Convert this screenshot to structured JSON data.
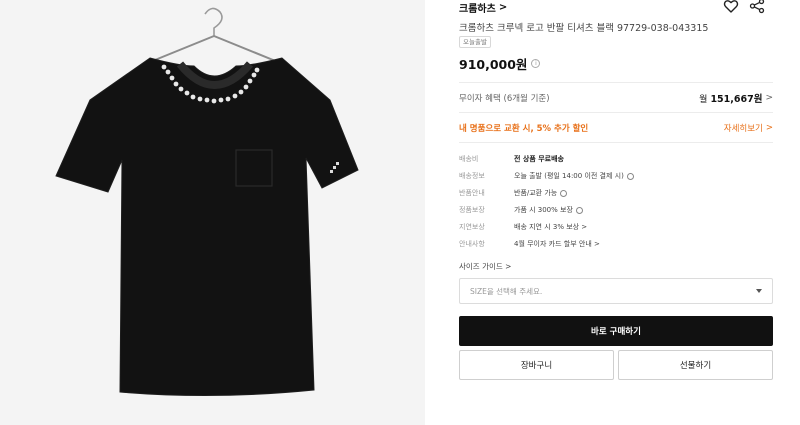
{
  "product": {
    "brand": "크롬하츠",
    "brand_chevron": ">",
    "title": "크롬하츠 크루넥 로고 반팔 티셔츠 블랙 97729-038-043315",
    "badge": "오늘출발",
    "price": "910,000원",
    "price_info_glyph": "i"
  },
  "installment": {
    "label": "무이자 혜택 (6개월 기준)",
    "prefix": "월",
    "amount": "151,667원"
  },
  "promo": {
    "label": "내 명품으로 교환 시, 5% 추가 할인",
    "link": "자세히보기"
  },
  "specs": [
    {
      "key": "배송비",
      "value": "전 상품 무료배송"
    },
    {
      "key": "배송정보",
      "value": "오늘 출발 (평일 14:00 이전 결제 시)"
    },
    {
      "key": "반품안내",
      "value": "반품/교환 가능"
    },
    {
      "key": "정품보장",
      "value": "가품 시 300% 보장"
    },
    {
      "key": "지연보상",
      "value": "배송 지연 시 3% 보상 >"
    },
    {
      "key": "안내사항",
      "value": "4월 무이자 카드 할부 안내 >"
    }
  ],
  "size_guide": "사이즈 가이드 >",
  "size_select": {
    "placeholder": "SIZE을 선택해 주세요."
  },
  "actions": {
    "buy": "바로 구매하기",
    "cart": "장바구니",
    "gift": "선물하기"
  },
  "image": {
    "subject": "black crew-neck t-shirt with white gothic logo print on collar",
    "neck_print": "CHROME HEARTS"
  }
}
